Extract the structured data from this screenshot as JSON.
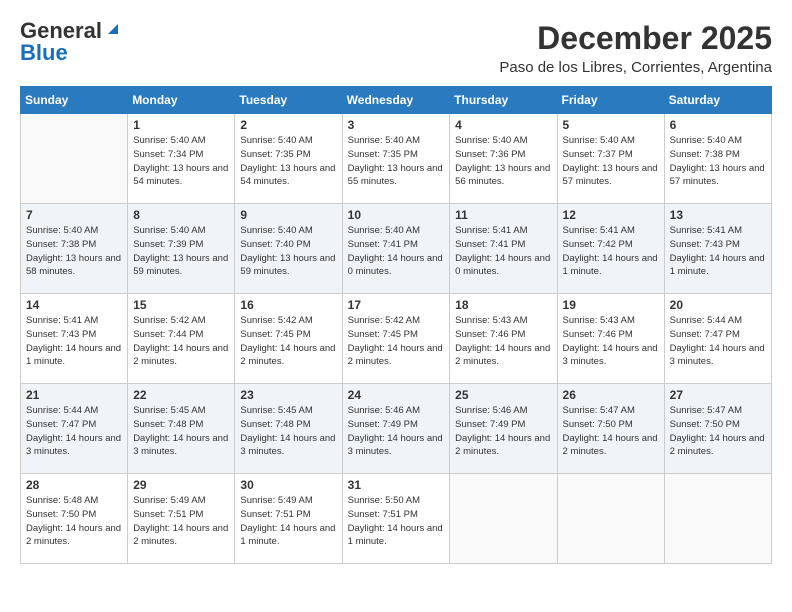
{
  "header": {
    "logo_general": "General",
    "logo_blue": "Blue",
    "month": "December 2025",
    "location": "Paso de los Libres, Corrientes, Argentina"
  },
  "weekdays": [
    "Sunday",
    "Monday",
    "Tuesday",
    "Wednesday",
    "Thursday",
    "Friday",
    "Saturday"
  ],
  "weeks": [
    [
      {
        "day": "",
        "empty": true
      },
      {
        "day": "1",
        "sunrise": "5:40 AM",
        "sunset": "7:34 PM",
        "daylight": "13 hours and 54 minutes."
      },
      {
        "day": "2",
        "sunrise": "5:40 AM",
        "sunset": "7:35 PM",
        "daylight": "13 hours and 54 minutes."
      },
      {
        "day": "3",
        "sunrise": "5:40 AM",
        "sunset": "7:35 PM",
        "daylight": "13 hours and 55 minutes."
      },
      {
        "day": "4",
        "sunrise": "5:40 AM",
        "sunset": "7:36 PM",
        "daylight": "13 hours and 56 minutes."
      },
      {
        "day": "5",
        "sunrise": "5:40 AM",
        "sunset": "7:37 PM",
        "daylight": "13 hours and 57 minutes."
      },
      {
        "day": "6",
        "sunrise": "5:40 AM",
        "sunset": "7:38 PM",
        "daylight": "13 hours and 57 minutes."
      }
    ],
    [
      {
        "day": "7",
        "sunrise": "5:40 AM",
        "sunset": "7:38 PM",
        "daylight": "13 hours and 58 minutes."
      },
      {
        "day": "8",
        "sunrise": "5:40 AM",
        "sunset": "7:39 PM",
        "daylight": "13 hours and 59 minutes."
      },
      {
        "day": "9",
        "sunrise": "5:40 AM",
        "sunset": "7:40 PM",
        "daylight": "13 hours and 59 minutes."
      },
      {
        "day": "10",
        "sunrise": "5:40 AM",
        "sunset": "7:41 PM",
        "daylight": "14 hours and 0 minutes."
      },
      {
        "day": "11",
        "sunrise": "5:41 AM",
        "sunset": "7:41 PM",
        "daylight": "14 hours and 0 minutes."
      },
      {
        "day": "12",
        "sunrise": "5:41 AM",
        "sunset": "7:42 PM",
        "daylight": "14 hours and 1 minute."
      },
      {
        "day": "13",
        "sunrise": "5:41 AM",
        "sunset": "7:43 PM",
        "daylight": "14 hours and 1 minute."
      }
    ],
    [
      {
        "day": "14",
        "sunrise": "5:41 AM",
        "sunset": "7:43 PM",
        "daylight": "14 hours and 1 minute."
      },
      {
        "day": "15",
        "sunrise": "5:42 AM",
        "sunset": "7:44 PM",
        "daylight": "14 hours and 2 minutes."
      },
      {
        "day": "16",
        "sunrise": "5:42 AM",
        "sunset": "7:45 PM",
        "daylight": "14 hours and 2 minutes."
      },
      {
        "day": "17",
        "sunrise": "5:42 AM",
        "sunset": "7:45 PM",
        "daylight": "14 hours and 2 minutes."
      },
      {
        "day": "18",
        "sunrise": "5:43 AM",
        "sunset": "7:46 PM",
        "daylight": "14 hours and 2 minutes."
      },
      {
        "day": "19",
        "sunrise": "5:43 AM",
        "sunset": "7:46 PM",
        "daylight": "14 hours and 3 minutes."
      },
      {
        "day": "20",
        "sunrise": "5:44 AM",
        "sunset": "7:47 PM",
        "daylight": "14 hours and 3 minutes."
      }
    ],
    [
      {
        "day": "21",
        "sunrise": "5:44 AM",
        "sunset": "7:47 PM",
        "daylight": "14 hours and 3 minutes."
      },
      {
        "day": "22",
        "sunrise": "5:45 AM",
        "sunset": "7:48 PM",
        "daylight": "14 hours and 3 minutes."
      },
      {
        "day": "23",
        "sunrise": "5:45 AM",
        "sunset": "7:48 PM",
        "daylight": "14 hours and 3 minutes."
      },
      {
        "day": "24",
        "sunrise": "5:46 AM",
        "sunset": "7:49 PM",
        "daylight": "14 hours and 3 minutes."
      },
      {
        "day": "25",
        "sunrise": "5:46 AM",
        "sunset": "7:49 PM",
        "daylight": "14 hours and 2 minutes."
      },
      {
        "day": "26",
        "sunrise": "5:47 AM",
        "sunset": "7:50 PM",
        "daylight": "14 hours and 2 minutes."
      },
      {
        "day": "27",
        "sunrise": "5:47 AM",
        "sunset": "7:50 PM",
        "daylight": "14 hours and 2 minutes."
      }
    ],
    [
      {
        "day": "28",
        "sunrise": "5:48 AM",
        "sunset": "7:50 PM",
        "daylight": "14 hours and 2 minutes."
      },
      {
        "day": "29",
        "sunrise": "5:49 AM",
        "sunset": "7:51 PM",
        "daylight": "14 hours and 2 minutes."
      },
      {
        "day": "30",
        "sunrise": "5:49 AM",
        "sunset": "7:51 PM",
        "daylight": "14 hours and 1 minute."
      },
      {
        "day": "31",
        "sunrise": "5:50 AM",
        "sunset": "7:51 PM",
        "daylight": "14 hours and 1 minute."
      },
      {
        "day": "",
        "empty": true
      },
      {
        "day": "",
        "empty": true
      },
      {
        "day": "",
        "empty": true
      }
    ]
  ]
}
